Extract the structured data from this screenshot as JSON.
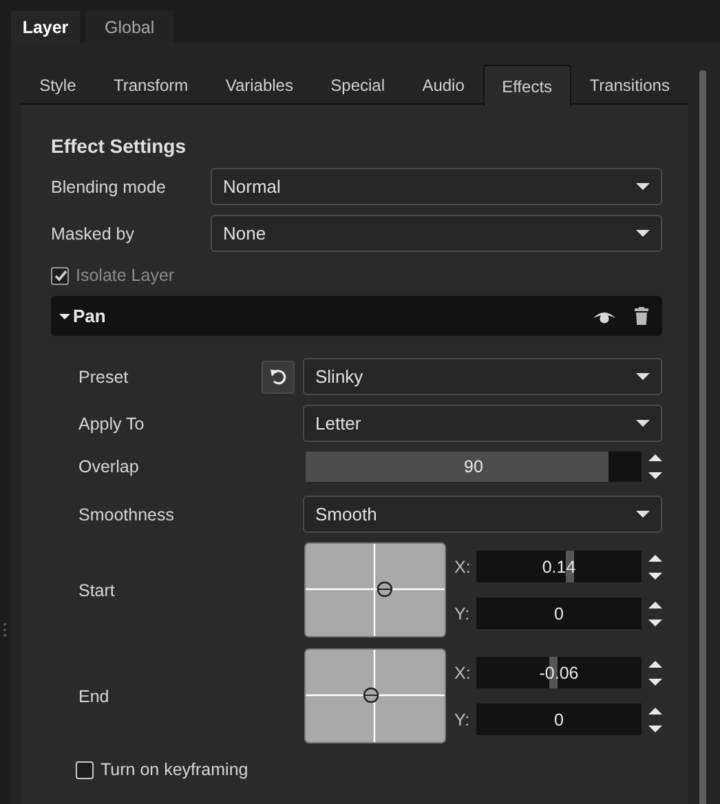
{
  "top_tabs": [
    {
      "label": "Layer",
      "selected": true
    },
    {
      "label": "Global",
      "selected": false
    }
  ],
  "tabs": [
    {
      "label": "Style",
      "selected": false
    },
    {
      "label": "Transform",
      "selected": false
    },
    {
      "label": "Variables",
      "selected": false
    },
    {
      "label": "Special",
      "selected": false
    },
    {
      "label": "Audio",
      "selected": false
    },
    {
      "label": "Effects",
      "selected": true
    },
    {
      "label": "Transitions",
      "selected": false
    }
  ],
  "section_title": "Effect Settings",
  "settings": [
    {
      "label": "Blending mode",
      "value": "Normal"
    },
    {
      "label": "Masked by",
      "value": "None"
    }
  ],
  "isolate_layer": {
    "label": "Isolate Layer",
    "checked": true,
    "disabled": true
  },
  "effect": {
    "name": "Pan",
    "expanded": true,
    "params": [
      {
        "kind": "dropdown",
        "label": "Preset",
        "value": "Slinky",
        "resettable": true
      },
      {
        "kind": "dropdown",
        "label": "Apply To",
        "value": "Letter"
      },
      {
        "kind": "slider",
        "label": "Overlap",
        "value": "90",
        "level": 0.9
      },
      {
        "kind": "dropdown",
        "label": "Smoothness",
        "value": "Smooth"
      },
      {
        "kind": "point",
        "label": "Start",
        "x": {
          "label": "X:",
          "value": "0.14",
          "level": 0.57
        },
        "y": {
          "label": "Y:",
          "value": "0"
        }
      },
      {
        "kind": "point",
        "label": "End",
        "x": {
          "label": "X:",
          "value": "-0.06",
          "level": 0.47
        },
        "y": {
          "label": "Y:",
          "value": "0"
        }
      }
    ]
  },
  "keyframing": {
    "label": "Turn on keyframing",
    "checked": false
  }
}
